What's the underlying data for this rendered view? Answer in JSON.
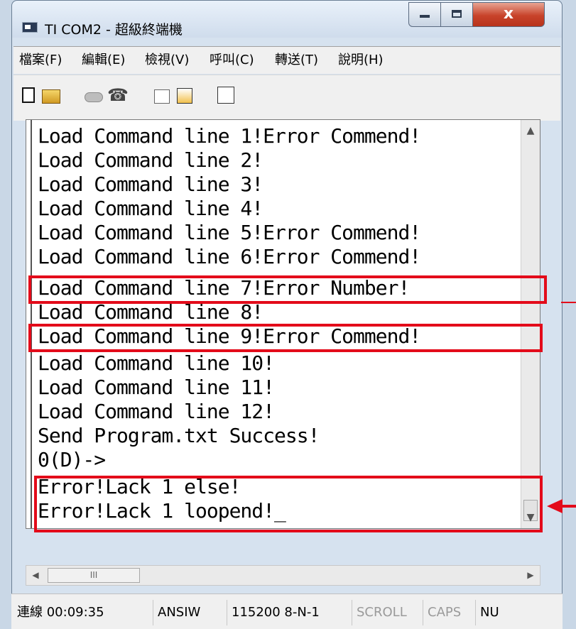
{
  "window": {
    "title": "TI COM2 - 超級終端機",
    "close_glyph": "x"
  },
  "menu": {
    "items": [
      {
        "label": "檔案(F)"
      },
      {
        "label": "編輯(E)"
      },
      {
        "label": "檢視(V)"
      },
      {
        "label": "呼叫(C)"
      },
      {
        "label": "轉送(T)"
      },
      {
        "label": "說明(H)"
      }
    ]
  },
  "toolbar": {
    "icons": [
      "new-file-icon",
      "open-folder-icon",
      "call-icon",
      "hang-up-icon",
      "send-icon",
      "receive-icon",
      "properties-icon"
    ]
  },
  "terminal": {
    "lines": [
      "Load Command line 1!Error Commend!",
      "Load Command line 2!",
      "Load Command line 3!",
      "Load Command line 4!",
      "Load Command line 5!Error Commend!",
      "Load Command line 6!Error Commend!",
      "Load Command line 7!Error Number!",
      "Load Command line 8!",
      "Load Command line 9!Error Commend!",
      "Load Command line 10!",
      "Load Command line 11!",
      "Load Command line 12!",
      "Send Program.txt Success!",
      "0(D)->",
      "Error!Lack 1 else!",
      "Error!Lack 1 loopend!_"
    ],
    "highlight_color": "#e30b1a"
  },
  "scrollbars": {
    "horizontal_thumb_grip": "III"
  },
  "status": {
    "connected": "連線 00:09:35",
    "emulation": "ANSIW",
    "port_settings": "115200 8-N-1",
    "scroll": "SCROLL",
    "caps": "CAPS",
    "num": "NU"
  }
}
